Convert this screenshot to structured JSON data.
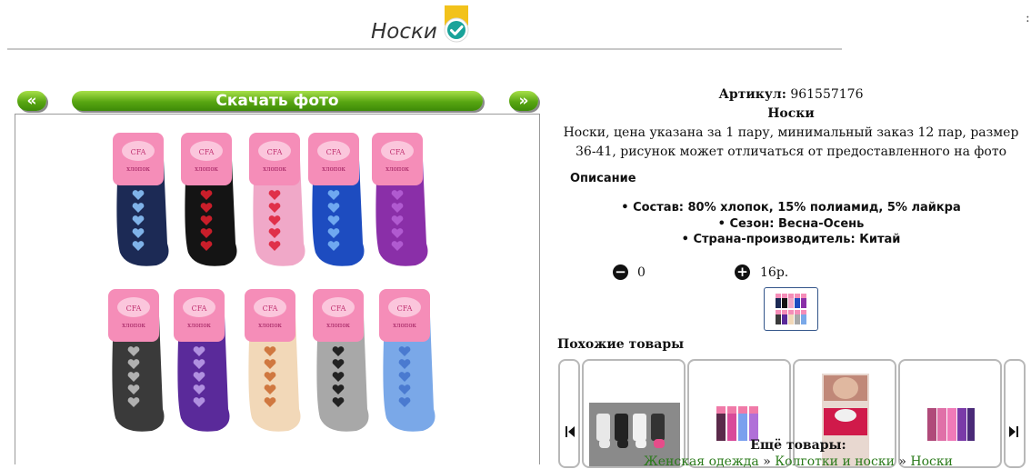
{
  "header": {
    "title": "Носки",
    "edge_char": ":"
  },
  "photo_controls": {
    "prev_label": "«",
    "download_label": "Скачать фото",
    "next_label": "»"
  },
  "product": {
    "sku_label": "Артикул:",
    "sku_value": "961557176",
    "name": "Носки",
    "description": "Носки, цена указана за 1 пару, минимальный заказ 12 пар, размер 36-41, рисунок может отличаться от предоставленного на фото"
  },
  "description_section": {
    "heading": "Описание",
    "specs": [
      "Состав: 80% хлопок, 15% полиамид, 5% лайкра",
      "Сезон: Весна-Осень",
      "Страна-производитель: Китай"
    ]
  },
  "order": {
    "minus": "−",
    "quantity": "0",
    "plus": "+",
    "price": "16р."
  },
  "similar": {
    "heading": "Похожие товары"
  },
  "more": {
    "heading": "Ещё товары:",
    "breadcrumb": [
      "Женская одежда",
      "Колготки и носки",
      "Носки"
    ],
    "separator": "»"
  },
  "package_label": {
    "brand": "CFA",
    "text": "хлопок"
  },
  "colors": {
    "accent_green": "#58a612",
    "link_green": "#2a7a1a",
    "badge_yellow": "#f2c21b",
    "badge_teal": "#1aa39a"
  }
}
